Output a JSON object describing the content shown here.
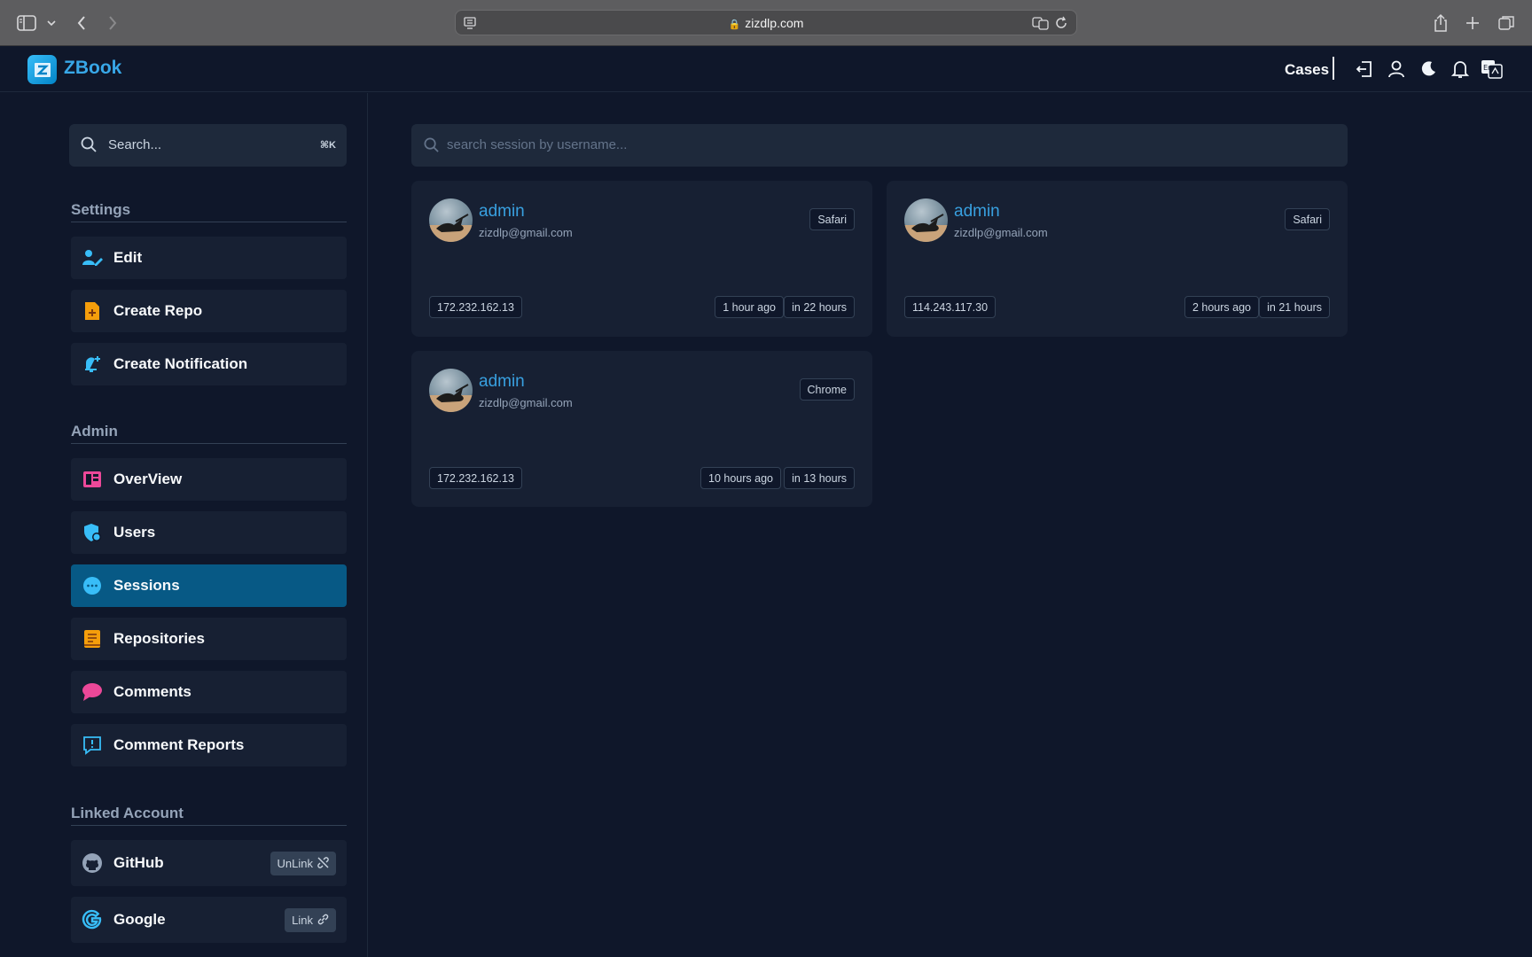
{
  "browser": {
    "url": "zizdlp.com"
  },
  "header": {
    "logo_text": "ZBook",
    "cases_label": "Cases"
  },
  "sidebar": {
    "search": {
      "placeholder": "Search...",
      "shortcut": "⌘K"
    },
    "settings_title": "Settings",
    "settings_items": [
      {
        "label": "Edit",
        "icon": "user-edit-icon",
        "color": "#38bdf8"
      },
      {
        "label": "Create Repo",
        "icon": "file-plus-icon",
        "color": "#f59e0b"
      },
      {
        "label": "Create Notification",
        "icon": "bell-plus-icon",
        "color": "#38bdf8"
      }
    ],
    "admin_title": "Admin",
    "admin_items": [
      {
        "label": "OverView",
        "icon": "overview-icon",
        "color": "#ec4899"
      },
      {
        "label": "Users",
        "icon": "shield-user-icon",
        "color": "#38bdf8"
      },
      {
        "label": "Sessions",
        "icon": "chat-bubble-icon",
        "color": "#38bdf8",
        "active": true
      },
      {
        "label": "Repositories",
        "icon": "book-icon",
        "color": "#f59e0b"
      },
      {
        "label": "Comments",
        "icon": "comment-icon",
        "color": "#ec4899"
      },
      {
        "label": "Comment Reports",
        "icon": "report-icon",
        "color": "#38bdf8"
      }
    ],
    "linked_title": "Linked Account",
    "linked_items": [
      {
        "label": "GitHub",
        "icon": "github-icon",
        "action": "UnLink"
      },
      {
        "label": "Google",
        "icon": "google-icon",
        "action": "Link"
      }
    ]
  },
  "main": {
    "search_placeholder": "search session by username...",
    "sessions": [
      {
        "username": "admin",
        "email": "zizdlp@gmail.com",
        "browser": "Safari",
        "ip": "172.232.162.13",
        "created": "1 hour ago",
        "expires": "in 22 hours"
      },
      {
        "username": "admin",
        "email": "zizdlp@gmail.com",
        "browser": "Safari",
        "ip": "114.243.117.30",
        "created": "2 hours ago",
        "expires": "in 21 hours"
      },
      {
        "username": "admin",
        "email": "zizdlp@gmail.com",
        "browser": "Chrome",
        "ip": "172.232.162.13",
        "created": "10 hours ago",
        "expires": "in 13 hours"
      }
    ]
  }
}
